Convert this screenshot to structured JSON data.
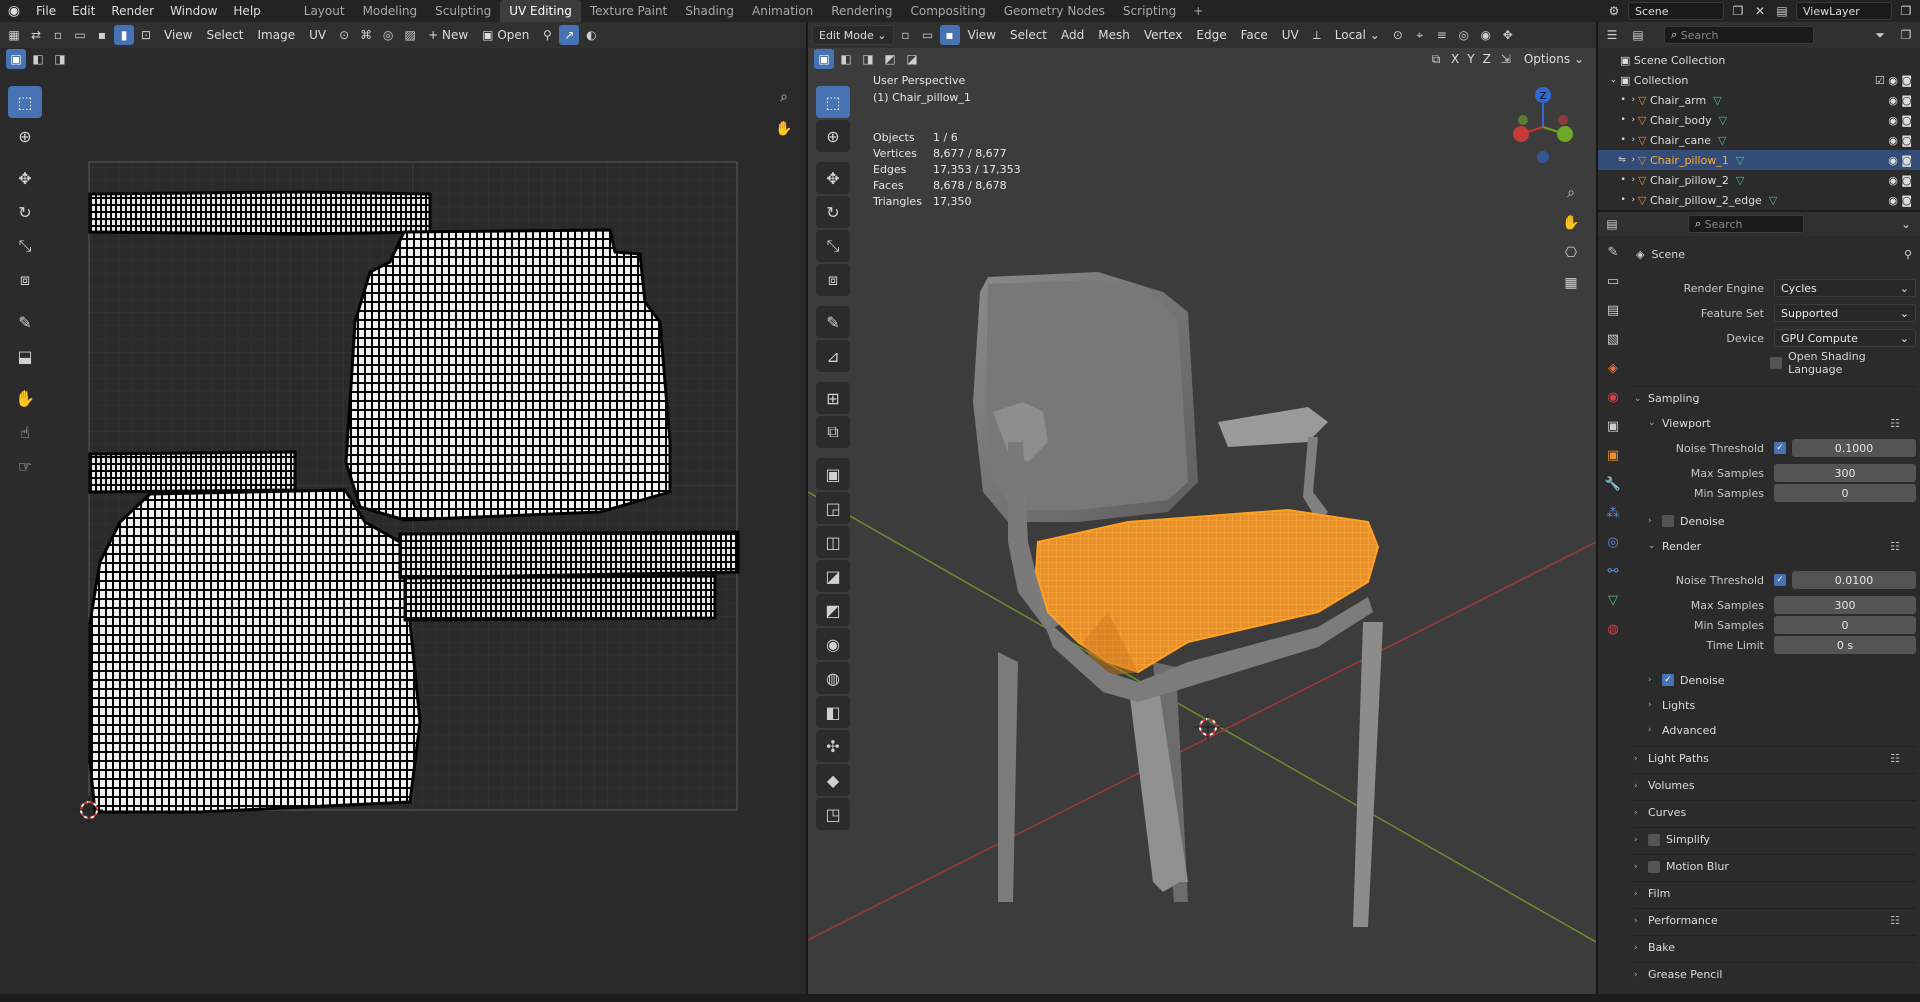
{
  "topbar": {
    "menus": [
      "File",
      "Edit",
      "Render",
      "Window",
      "Help"
    ],
    "workspaces": [
      "Layout",
      "Modeling",
      "Sculpting",
      "UV Editing",
      "Texture Paint",
      "Shading",
      "Animation",
      "Rendering",
      "Compositing",
      "Geometry Nodes",
      "Scripting"
    ],
    "active_workspace": "UV Editing",
    "scene": "Scene",
    "view_layer": "ViewLayer"
  },
  "uv_editor": {
    "menus": [
      "View",
      "Select",
      "Image",
      "UV"
    ],
    "new_label": "New",
    "open_label": "Open"
  },
  "viewport": {
    "mode": "Edit Mode",
    "menus": [
      "View",
      "Select",
      "Add",
      "Mesh",
      "Vertex",
      "Edge",
      "Face",
      "UV"
    ],
    "orientation": "Local",
    "options_label": "Options",
    "axes": [
      "X",
      "Y",
      "Z"
    ],
    "perspective": "User Perspective",
    "object_name": "(1) Chair_pillow_1",
    "stats": [
      {
        "label": "Objects",
        "value": "1 / 6"
      },
      {
        "label": "Vertices",
        "value": "8,677 / 8,677"
      },
      {
        "label": "Edges",
        "value": "17,353 / 17,353"
      },
      {
        "label": "Faces",
        "value": "8,678 / 8,678"
      },
      {
        "label": "Triangles",
        "value": "17,350"
      }
    ]
  },
  "outliner": {
    "search_placeholder": "Search",
    "root": "Scene Collection",
    "collection": "Collection",
    "items": [
      "Chair_arm",
      "Chair_body",
      "Chair_cane",
      "Chair_pillow_1",
      "Chair_pillow_2",
      "Chair_pillow_2_edge"
    ],
    "selected": "Chair_pillow_1"
  },
  "properties": {
    "search_placeholder": "Search",
    "context": "Scene",
    "render_engine_label": "Render Engine",
    "render_engine": "Cycles",
    "feature_set_label": "Feature Set",
    "feature_set": "Supported",
    "device_label": "Device",
    "device": "GPU Compute",
    "osl_label": "Open Shading Language",
    "sampling": "Sampling",
    "viewport_label": "Viewport",
    "vp_noise_label": "Noise Threshold",
    "vp_noise": "0.1000",
    "vp_max_label": "Max Samples",
    "vp_max": "300",
    "vp_min_label": "Min Samples",
    "vp_min": "0",
    "denoise_label": "Denoise",
    "render_label": "Render",
    "r_noise_label": "Noise Threshold",
    "r_noise": "0.0100",
    "r_max_label": "Max Samples",
    "r_max": "300",
    "r_min_label": "Min Samples",
    "r_min": "0",
    "r_time_label": "Time Limit",
    "r_time": "0 s",
    "r_denoise_label": "Denoise",
    "lights": "Lights",
    "advanced": "Advanced",
    "panels": [
      "Light Paths",
      "Volumes",
      "Curves",
      "Simplify",
      "Motion Blur",
      "Film",
      "Performance",
      "Bake",
      "Grease Pencil"
    ]
  },
  "colors": {
    "accent": "#4772b3",
    "selection": "#ffa020",
    "uv_mesh": "#000000"
  }
}
